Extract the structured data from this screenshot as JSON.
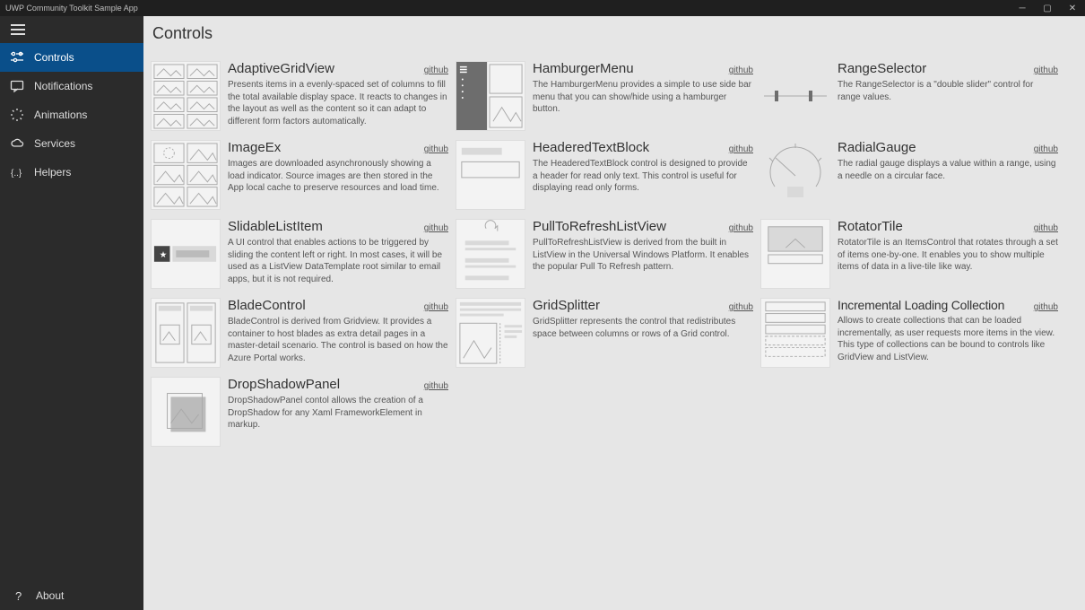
{
  "app_title": "UWP Community Toolkit Sample App",
  "page_title": "Controls",
  "sidebar": {
    "items": [
      {
        "label": "Controls"
      },
      {
        "label": "Notifications"
      },
      {
        "label": "Animations"
      },
      {
        "label": "Services"
      },
      {
        "label": "Helpers"
      }
    ],
    "about_label": "About"
  },
  "github_label": "github",
  "tiles": [
    {
      "title": "AdaptiveGridView",
      "desc": "Presents items in a evenly-spaced set of columns to fill the total available display space. It reacts to changes in the layout as well as the content so it can adapt to different form factors automatically."
    },
    {
      "title": "HamburgerMenu",
      "desc": "The HamburgerMenu provides a simple to use side bar menu that you can show/hide using a hamburger button."
    },
    {
      "title": "RangeSelector",
      "desc": "The RangeSelector is a \"double slider\" control for range values."
    },
    {
      "title": "ImageEx",
      "desc": "Images are downloaded asynchronously showing a load indicator. Source images are then stored in the App local cache to preserve resources and load time."
    },
    {
      "title": "HeaderedTextBlock",
      "desc": "The HeaderedTextBlock control is designed to provide a header for read only text. This control is useful for displaying read only forms."
    },
    {
      "title": "RadialGauge",
      "desc": "The radial gauge displays a value within a range, using a needle on a circular face."
    },
    {
      "title": "SlidableListItem",
      "desc": "A UI control that enables actions to be triggered by sliding the content left or right. In most cases, it will be used as a ListView DataTemplate root similar to email apps, but it is not required."
    },
    {
      "title": "PullToRefreshListView",
      "desc": "PullToRefreshListView is derived from the built in ListView in the Universal Windows Platform. It enables the popular Pull To Refresh pattern."
    },
    {
      "title": "RotatorTile",
      "desc": "RotatorTile is an ItemsControl that rotates through a set of items one-by-one. It enables you to show multiple items of data in a live-tile like way."
    },
    {
      "title": "BladeControl",
      "desc": "BladeControl is derived from Gridview. It provides a container to host blades as extra detail pages in a master-detail scenario. The control is based on how the Azure Portal works."
    },
    {
      "title": "GridSplitter",
      "desc": "GridSplitter represents the control that redistributes space between columns or rows of a Grid control."
    },
    {
      "title": "Incremental Loading Collection",
      "desc": "Allows to create collections that can be loaded incrementally, as user requests more items in the view. This type of collections can be bound to controls like GridView and ListView."
    },
    {
      "title": "DropShadowPanel",
      "desc": "DropShadowPanel contol allows the creation of a DropShadow for any Xaml FrameworkElement in markup."
    }
  ]
}
